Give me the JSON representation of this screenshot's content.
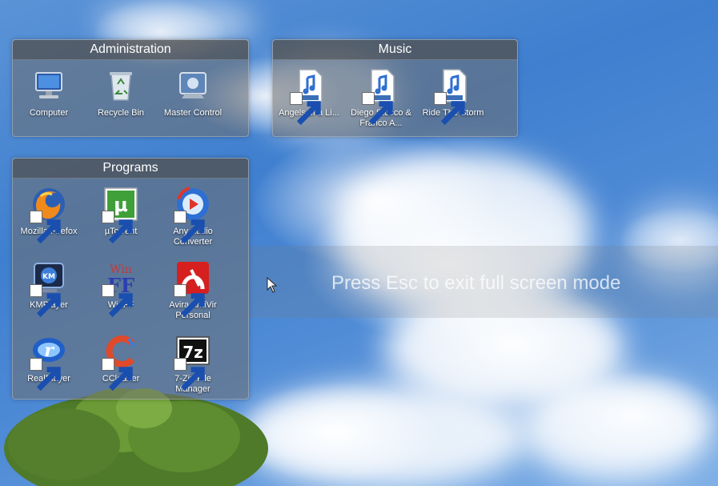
{
  "overlay": {
    "message": "Press Esc to exit full screen mode"
  },
  "colors": {
    "fence_bg": "#6e6e6e",
    "fence_title_bg": "#464646",
    "label": "#ffffff"
  },
  "fences": {
    "administration": {
      "title": "Administration",
      "items": [
        {
          "label": "Computer",
          "icon": "computer-icon"
        },
        {
          "label": "Recycle Bin",
          "icon": "recycle-bin-icon"
        },
        {
          "label": "Master Control",
          "icon": "master-control-icon"
        }
      ]
    },
    "music": {
      "title": "Music",
      "items": [
        {
          "label": "Angels of a Li...",
          "icon": "mp3-file-icon"
        },
        {
          "label": "Diego Stocco & Franco A...",
          "icon": "mp3-file-icon"
        },
        {
          "label": "Ride The Storm",
          "icon": "mp3-file-icon"
        }
      ]
    },
    "programs": {
      "title": "Programs",
      "items": [
        {
          "label": "Mozilla Firefox",
          "icon": "firefox-icon"
        },
        {
          "label": "µTorrent",
          "icon": "utorrent-icon"
        },
        {
          "label": "Any Audio Converter",
          "icon": "audio-converter-icon"
        },
        {
          "label": "KMPlayer",
          "icon": "kmplayer-icon"
        },
        {
          "label": "WinFF",
          "icon": "winff-icon"
        },
        {
          "label": "Avira AntiVir Personal",
          "icon": "avira-icon"
        },
        {
          "label": "RealPlayer",
          "icon": "realplayer-icon"
        },
        {
          "label": "CCleaner",
          "icon": "ccleaner-icon"
        },
        {
          "label": "7-Zip File Manager",
          "icon": "7zip-icon"
        }
      ]
    }
  }
}
